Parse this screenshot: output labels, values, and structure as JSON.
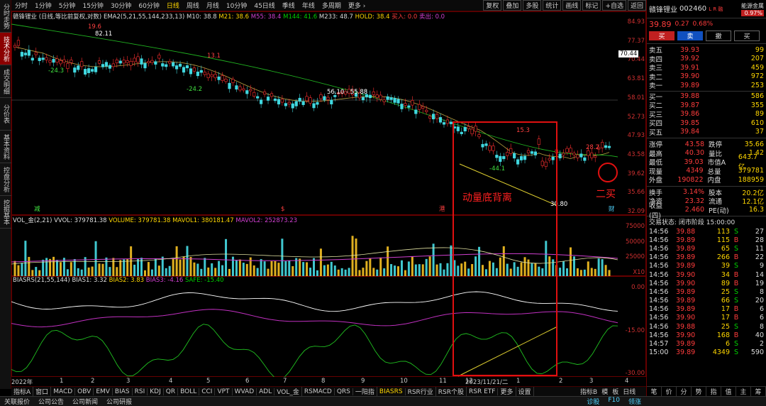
{
  "side_tabs": [
    "分时走势",
    "技术分析",
    "成交明细",
    "分价表",
    "基本资料",
    "控盘分析",
    "挖掘基本"
  ],
  "period_tabs": [
    "分时",
    "1分钟",
    "5分钟",
    "15分钟",
    "30分钟",
    "60分钟",
    "日线",
    "周线",
    "月线",
    "10分钟",
    "45日线",
    "季线",
    "年线",
    "多周期",
    "更多 ›"
  ],
  "active_period": "日线",
  "top_buttons": [
    "复权",
    "叠加",
    "多股",
    "统计",
    "画线",
    "标记",
    "+自选",
    "返回"
  ],
  "stock_title": "赣锋锂业 (日线,等比前复权,对数)",
  "ema_legend": {
    "name": "EMA2(5,21,55,144,233,13)",
    "m10": "M10: 38.8",
    "m21": "M21: 38.6",
    "m55": "M55: 38.4",
    "m144": "M144: 41.6",
    "m233": "M233: 48.7",
    "hold": "HOLD: 38.4",
    "buy": "买入: 0.0",
    "sell": "卖出: 0.0"
  },
  "price_axis": [
    "84.93",
    "77.37",
    "70.44",
    "63.81",
    "58.01",
    "52.73",
    "47.93",
    "43.58",
    "39.62",
    "35.66",
    "32.09"
  ],
  "price_labels": {
    "p1": "19.6",
    "p2": "82.11",
    "p3": "13.1",
    "p4": "-24.3",
    "p5": "-24.2",
    "p6": "56.10 - 55.88",
    "p7": "15.3",
    "p8": "-44.1",
    "p9": "28.2",
    "p10": "30.80",
    "p11": "70.44"
  },
  "annotations": {
    "divergence": "动量底背离",
    "buy2": "二买"
  },
  "markers": [
    "减",
    "$",
    "港",
    "财"
  ],
  "vol_legend": {
    "name": "VOL_金(2,21)",
    "vvol": "VVOL: 379781.38",
    "volume": "VOLUME: 379781.38",
    "mavol1": "MAVOL1: 380181.47",
    "mavol2": "MAVOL2: 252873.23"
  },
  "vol_axis": [
    "75000",
    "50000",
    "25000",
    "X10"
  ],
  "bias_legend": {
    "name": "BIASRS(21,55,144)",
    "b1": "BIAS1: 3.32",
    "b2": "BIAS2: 3.83",
    "b3": "BIAS3: -4.16",
    "safe": "SAFE: -15.40"
  },
  "bias_axis": [
    "0.00",
    "-15.00",
    "-30.00"
  ],
  "date_axis": [
    "2022年",
    "1",
    "2",
    "3",
    "4",
    "5",
    "6",
    "7",
    "8",
    "9",
    "10",
    "11",
    "12",
    "2023/11/21/二",
    "1",
    "2",
    "3",
    "4"
  ],
  "bottom_tabs": [
    "指标A",
    "窗口",
    "MACD",
    "OBV",
    "EMV",
    "BIAS",
    "RSI",
    "KDJ",
    "QR",
    "BOLL",
    "CCI",
    "VPT",
    "WVAD",
    "ADL",
    "VOL_金",
    "RSMACD",
    "QRS",
    "一阳指",
    "BIASRS",
    "RSR行业",
    "RSR个股",
    "RSR ETF",
    "更多",
    "设置"
  ],
  "active_bottom": "BIASRS",
  "bottom_right": [
    "指标B",
    "模",
    "板",
    "日线"
  ],
  "status_items": [
    "关联报价",
    "公司公告",
    "公司新闻",
    "公司研报"
  ],
  "status_right": [
    "诊股",
    "F10",
    "领涨"
  ],
  "right": {
    "name": "赣锋锂业",
    "code": "002460",
    "tag": "L R 融",
    "sector": "能源金属",
    "sector_pct": "0.97%",
    "price": "39.89",
    "change": "0.27",
    "pct": "0.68%",
    "buttons": [
      "买",
      "卖",
      "撤",
      "买"
    ],
    "asks": [
      [
        "卖五",
        "39.93",
        "99"
      ],
      [
        "卖四",
        "39.92",
        "207"
      ],
      [
        "卖三",
        "39.91",
        "459"
      ],
      [
        "卖二",
        "39.90",
        "972"
      ],
      [
        "卖一",
        "39.89",
        "253"
      ]
    ],
    "bids": [
      [
        "买一",
        "39.88",
        "586"
      ],
      [
        "买二",
        "39.87",
        "355"
      ],
      [
        "买三",
        "39.86",
        "89"
      ],
      [
        "买四",
        "39.85",
        "610"
      ],
      [
        "买五",
        "39.84",
        "37"
      ]
    ],
    "stats": [
      [
        "涨停",
        "43.58",
        "跌停",
        "35.66"
      ],
      [
        "最高",
        "40.30",
        "量比",
        "1.42"
      ],
      [
        "最低",
        "39.03",
        "市值A",
        "643.7亿"
      ],
      [
        "现量",
        "4349",
        "总量",
        "379781"
      ],
      [
        "外盘",
        "190822",
        "内盘",
        "188959"
      ]
    ],
    "stats2": [
      [
        "换手",
        "3.14%",
        "股本",
        "20.2亿"
      ],
      [
        "净资",
        "23.32",
        "流通",
        "12.1亿"
      ],
      [
        "收益(四)",
        "2.460",
        "PE(动)",
        "16.3"
      ]
    ],
    "trade_status": "交易状态: 闭市阶段 15:00:00",
    "ticks": [
      [
        "14:56",
        "39.88",
        "113",
        "S",
        "27"
      ],
      [
        "14:56",
        "39.89",
        "115",
        "B",
        "28"
      ],
      [
        "14:56",
        "39.89",
        "65",
        "S",
        "11"
      ],
      [
        "14:56",
        "39.89",
        "266",
        "B",
        "22"
      ],
      [
        "14:56",
        "39.89",
        "39",
        "S",
        "9"
      ],
      [
        "14:56",
        "39.90",
        "34",
        "B",
        "14"
      ],
      [
        "14:56",
        "39.90",
        "89",
        "B",
        "19"
      ],
      [
        "14:56",
        "39.89",
        "25",
        "S",
        "8"
      ],
      [
        "14:56",
        "39.89",
        "66",
        "S",
        "20"
      ],
      [
        "14:56",
        "39.89",
        "17",
        "B",
        "6"
      ],
      [
        "14:56",
        "39.90",
        "17",
        "B",
        "6"
      ],
      [
        "14:56",
        "39.88",
        "25",
        "S",
        "8"
      ],
      [
        "14:56",
        "39.90",
        "168",
        "B",
        "40"
      ],
      [
        "14:57",
        "39.89",
        "6",
        "S",
        "2"
      ],
      [
        "15:00",
        "39.89",
        "4349",
        "S",
        "590"
      ]
    ],
    "footer_tabs": [
      "笔",
      "价",
      "分",
      "势",
      "指",
      "值",
      "主",
      "筹"
    ]
  }
}
